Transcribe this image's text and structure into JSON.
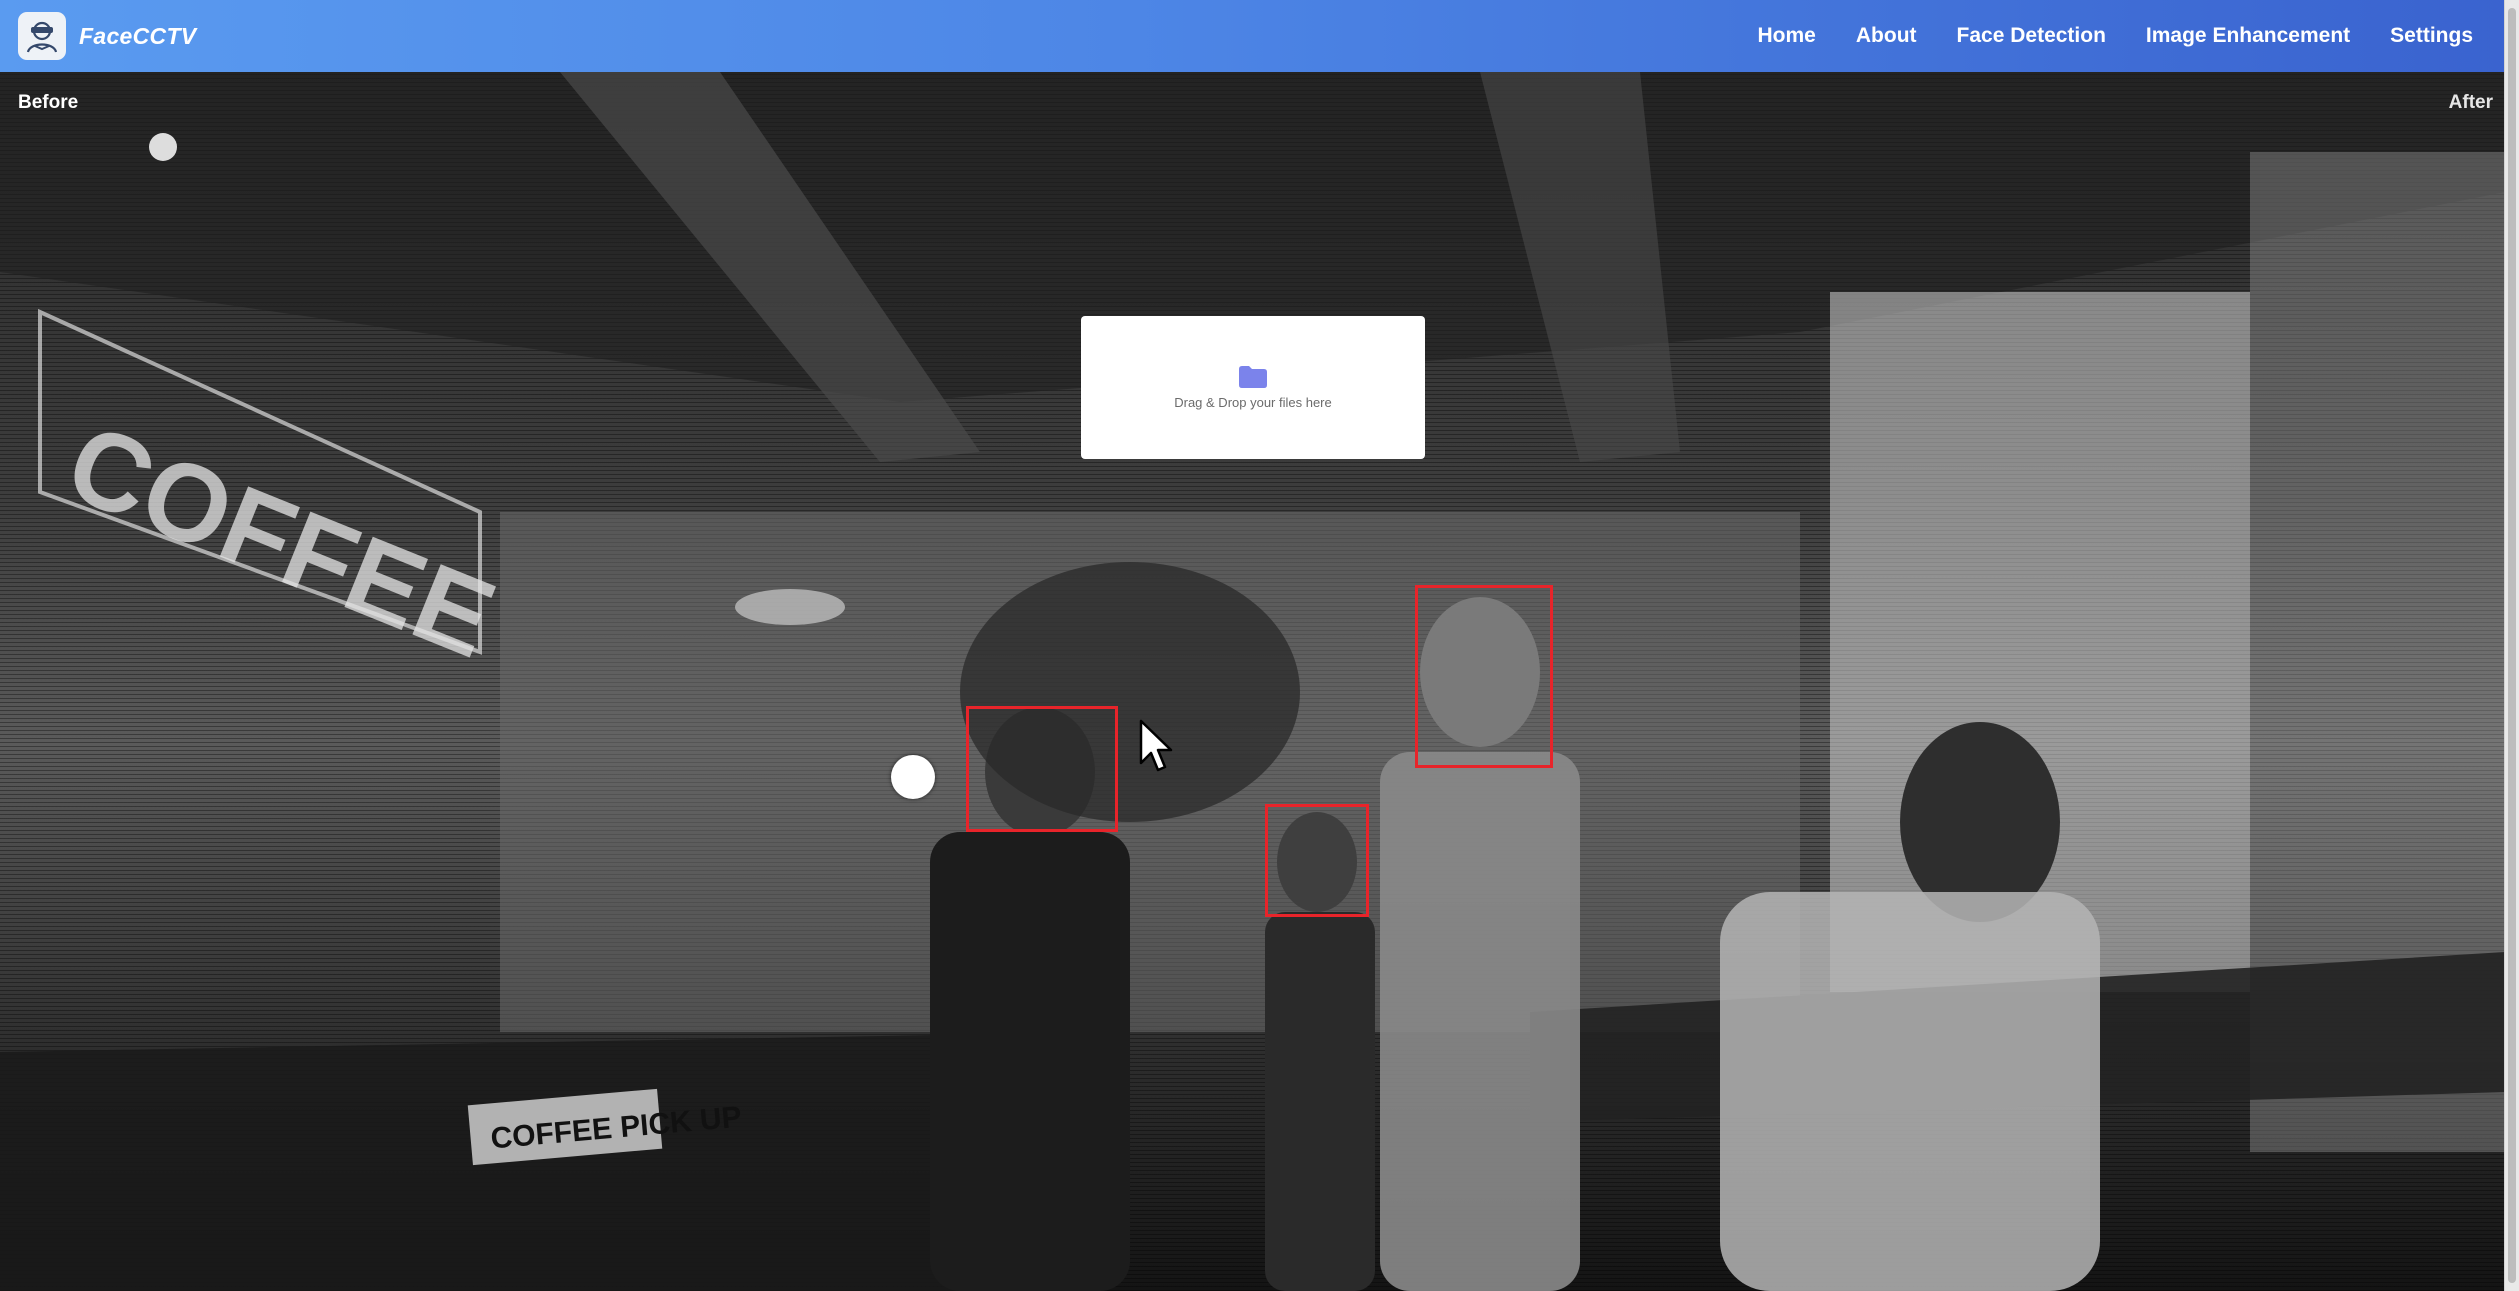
{
  "app": {
    "name": "FaceCCTV",
    "logo_icon": "cctv-user-icon"
  },
  "nav": {
    "items": [
      {
        "label": "Home"
      },
      {
        "label": "About"
      },
      {
        "label": "Face Detection"
      },
      {
        "label": "Image Enhancement"
      },
      {
        "label": "Settings"
      }
    ]
  },
  "comparison": {
    "before_label": "Before",
    "after_label": "After"
  },
  "upload": {
    "icon": "folder-icon",
    "text": "Drag & Drop your files here"
  },
  "detections": {
    "face_count": 3,
    "box_color": "#e8242a"
  },
  "colors": {
    "nav_gradient_start": "#5a9bf0",
    "nav_gradient_end": "#3a63cf",
    "folder_icon": "#7b83eb"
  }
}
